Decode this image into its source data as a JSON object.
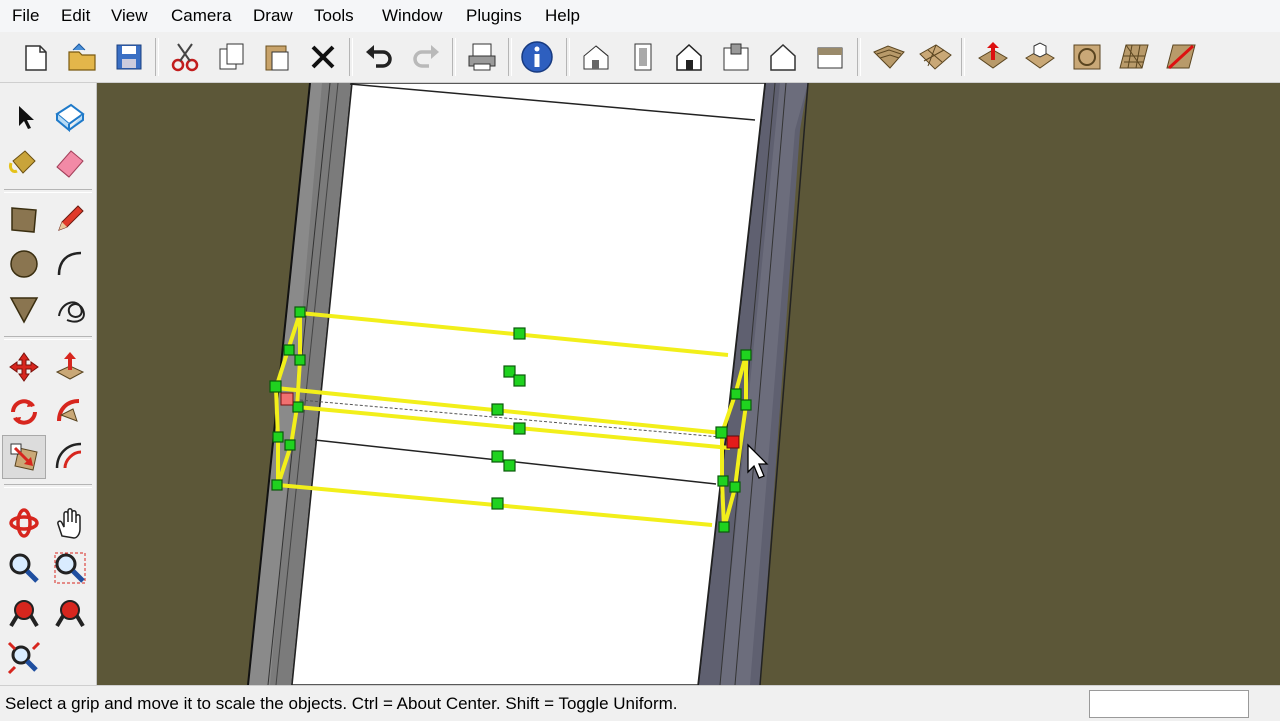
{
  "menu": [
    "File",
    "Edit",
    "View",
    "Camera",
    "Draw",
    "Tools",
    "Window",
    "Plugins",
    "Help"
  ],
  "toolbar_icons": [
    "new-document-icon",
    "open-folder-icon",
    "save-icon",
    "cut-icon",
    "copy-icon",
    "paste-icon",
    "erase-icon",
    "undo-icon",
    "redo-icon",
    "print-icon",
    "model-info-icon",
    "iso-view-icon",
    "top-view-icon",
    "front-view-icon",
    "right-view-icon",
    "back-view-icon",
    "left-view-icon",
    "sandbox-from-contours-icon",
    "sandbox-from-scratch-icon",
    "smoove-icon",
    "stamp-icon",
    "drape-icon",
    "add-detail-icon",
    "flip-edge-icon"
  ],
  "tools_icons": [
    "select-icon",
    "make-component-icon",
    "paint-bucket-icon",
    "eraser-icon",
    "rectangle-icon",
    "pencil-icon",
    "circle-icon",
    "arc-icon",
    "polygon-icon",
    "freehand-icon",
    "move-icon",
    "push-pull-icon",
    "rotate-icon",
    "follow-me-icon",
    "scale-icon",
    "offset-icon",
    "orbit-icon",
    "pan-icon",
    "zoom-icon",
    "zoom-window-icon",
    "previous-view-icon",
    "next-view-icon",
    "zoom-extents-icon"
  ],
  "status": {
    "message": "Select a grip and move it to scale the objects. Ctrl = About Center. Shift = Toggle Uniform.",
    "measurements_value": ""
  },
  "colors": {
    "background": "#5c5738",
    "selection": "#f2ef1a",
    "grip": "#1fd21f",
    "active_grip": "#e21b1b"
  }
}
